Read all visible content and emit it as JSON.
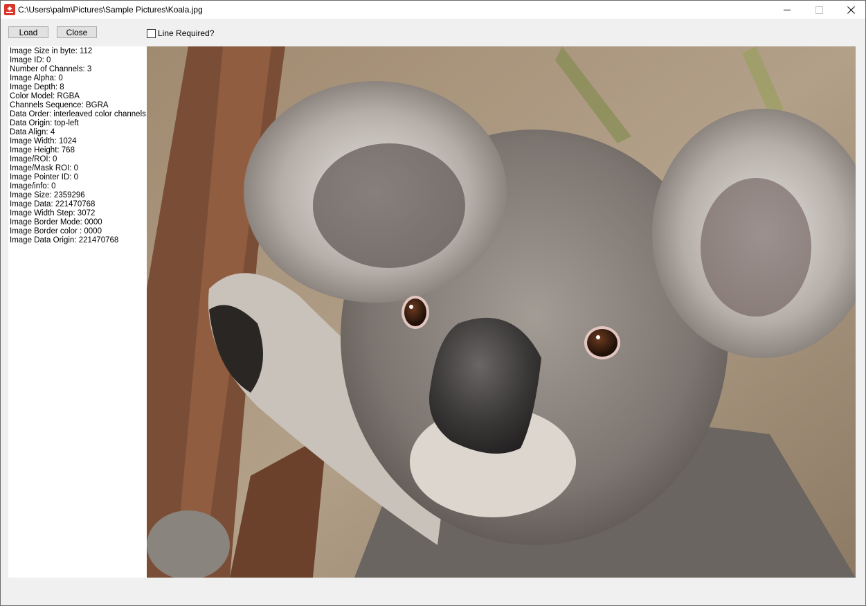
{
  "window": {
    "title": "C:\\Users\\palm\\Pictures\\Sample Pictures\\Koala.jpg",
    "icon": "app-icon",
    "controls": [
      "minimize-icon",
      "maximize-icon",
      "close-icon"
    ]
  },
  "toolbar": {
    "load_label": "Load",
    "close_label": "Close",
    "line_required_label": "Line Required?",
    "line_required_checked": false
  },
  "info": [
    "Image Size in byte: 112",
    "Image ID: 0",
    "Number of Channels: 3",
    "Image Alpha: 0",
    "Image Depth: 8",
    "Color Model: RGBA",
    "Channels Sequence: BGRA",
    "Data Order: interleaved color channels",
    "Data Origin: top-left",
    "Data Align: 4",
    "Image Width: 1024",
    "Image Height: 768",
    "Image/ROI: 0",
    "Image/Mask ROI: 0",
    "Image Pointer ID: 0",
    "Image/info: 0",
    "Image Size: 2359296",
    "Image Data: 221470768",
    "Image Width Step: 3072",
    "Image Border Mode: 0000",
    "Image Border color : 0000",
    "Image Data Origin: 221470768"
  ],
  "image": {
    "subject": "koala photo"
  },
  "colors": {
    "window_bg": "#f0f0f0",
    "button_bg": "#e1e1e1",
    "button_border": "#adadad",
    "app_icon": "#d8352b"
  }
}
